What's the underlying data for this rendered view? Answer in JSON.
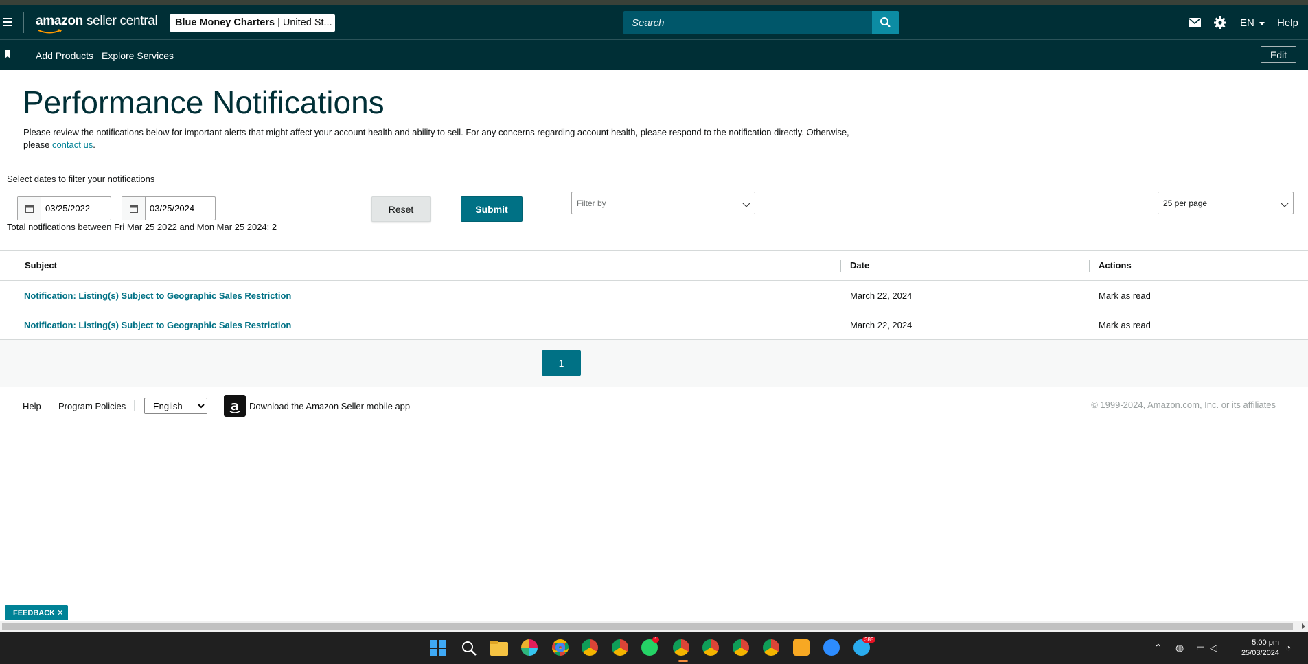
{
  "header": {
    "logo_main": "amazon",
    "logo_sub": "seller central",
    "account_name": "Blue Money Charters",
    "account_region": "| United St...",
    "search_placeholder": "Search",
    "language": "EN",
    "help": "Help"
  },
  "subnav": {
    "items": [
      "Add Products",
      "Explore Services"
    ],
    "edit_label": "Edit"
  },
  "page": {
    "title": "Performance Notifications",
    "description": "Please review the notifications below for important alerts that might affect your account health and ability to sell. For any concerns regarding account health, please respond to the notification directly. Otherwise, please",
    "contact_link": "contact us",
    "description_end": "."
  },
  "filters": {
    "date_label": "Select dates to filter your notifications",
    "start_date": "03/25/2022",
    "end_date": "03/25/2024",
    "reset_label": "Reset",
    "submit_label": "Submit",
    "filter_by_placeholder": "Filter by",
    "per_page": "25 per page",
    "total_text": "Total notifications between Fri Mar 25 2022 and Mon Mar 25 2024: 2"
  },
  "table": {
    "columns": [
      "Subject",
      "Date",
      "Actions"
    ],
    "rows": [
      {
        "subject": "Notification: Listing(s) Subject to Geographic Sales Restriction",
        "date": "March 22, 2024",
        "action": "Mark as read"
      },
      {
        "subject": "Notification: Listing(s) Subject to Geographic Sales Restriction",
        "date": "March 22, 2024",
        "action": "Mark as read"
      }
    ]
  },
  "pagination": {
    "current_page": "1"
  },
  "footer": {
    "help": "Help",
    "program_policies": "Program Policies",
    "language_select": "English",
    "app_text": "Download the Amazon Seller mobile app",
    "copyright": "© 1999-2024, Amazon.com, Inc. or its affiliates"
  },
  "feedback": {
    "label": "FEEDBACK ✕"
  },
  "taskbar": {
    "time": "5:00 pm",
    "date": "25/03/2024",
    "badges": {
      "whatsapp": "1",
      "telegram": "385"
    }
  },
  "colors": {
    "nav_bg": "#002f36",
    "accent": "#007185",
    "link": "#008296",
    "search_bg": "#00576a"
  }
}
